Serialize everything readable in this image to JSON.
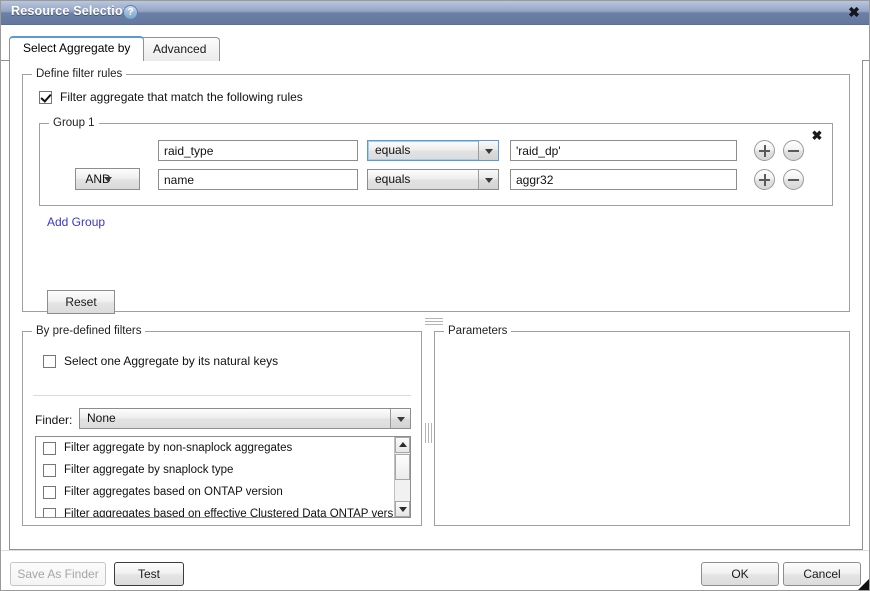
{
  "window": {
    "title": "Resource Selection",
    "help_icon": "question-mark-icon",
    "close_label": "✖"
  },
  "tabs": [
    {
      "label": "Select Aggregate by",
      "active": true
    },
    {
      "label": "Advanced",
      "active": false
    }
  ],
  "define_filter_rules": {
    "legend": "Define filter rules",
    "enable_checkbox": {
      "label": "Filter aggregate that match the following rules",
      "checked": true
    },
    "group": {
      "legend": "Group 1",
      "close_label": "✖",
      "rows": [
        {
          "logic": null,
          "field": "raid_type",
          "operator": "equals",
          "value": "'raid_dp'",
          "add_label": "+",
          "remove_label": "−"
        },
        {
          "logic": "AND",
          "field": "name",
          "operator": "equals",
          "value": "aggr32",
          "add_label": "+",
          "remove_label": "−"
        }
      ]
    },
    "add_group_link": "Add Group",
    "reset_button": "Reset"
  },
  "predefined_filters": {
    "legend": "By pre-defined filters",
    "natural_keys_checkbox": {
      "label": "Select one Aggregate by its natural keys",
      "checked": false
    },
    "finder_label": "Finder:",
    "finder_value": "None",
    "filter_list": [
      {
        "label": "Filter aggregate by non-snaplock aggregates",
        "checked": false
      },
      {
        "label": "Filter aggregate by snaplock type",
        "checked": false
      },
      {
        "label": "Filter aggregates based on ONTAP version",
        "checked": false
      },
      {
        "label": "Filter aggregates based on effective Clustered Data ONTAP version",
        "checked": false
      }
    ]
  },
  "parameters": {
    "legend": "Parameters"
  },
  "footer": {
    "save_as_finder": "Save As Finder",
    "save_as_finder_disabled": true,
    "test": "Test",
    "ok": "OK",
    "cancel": "Cancel"
  },
  "colors": {
    "titlebar_top": "#b9c6dd",
    "titlebar_bottom": "#63779f",
    "accent_tab": "#5b9bd5",
    "link": "#3a36d0",
    "focus_border": "#5b9bd5"
  }
}
